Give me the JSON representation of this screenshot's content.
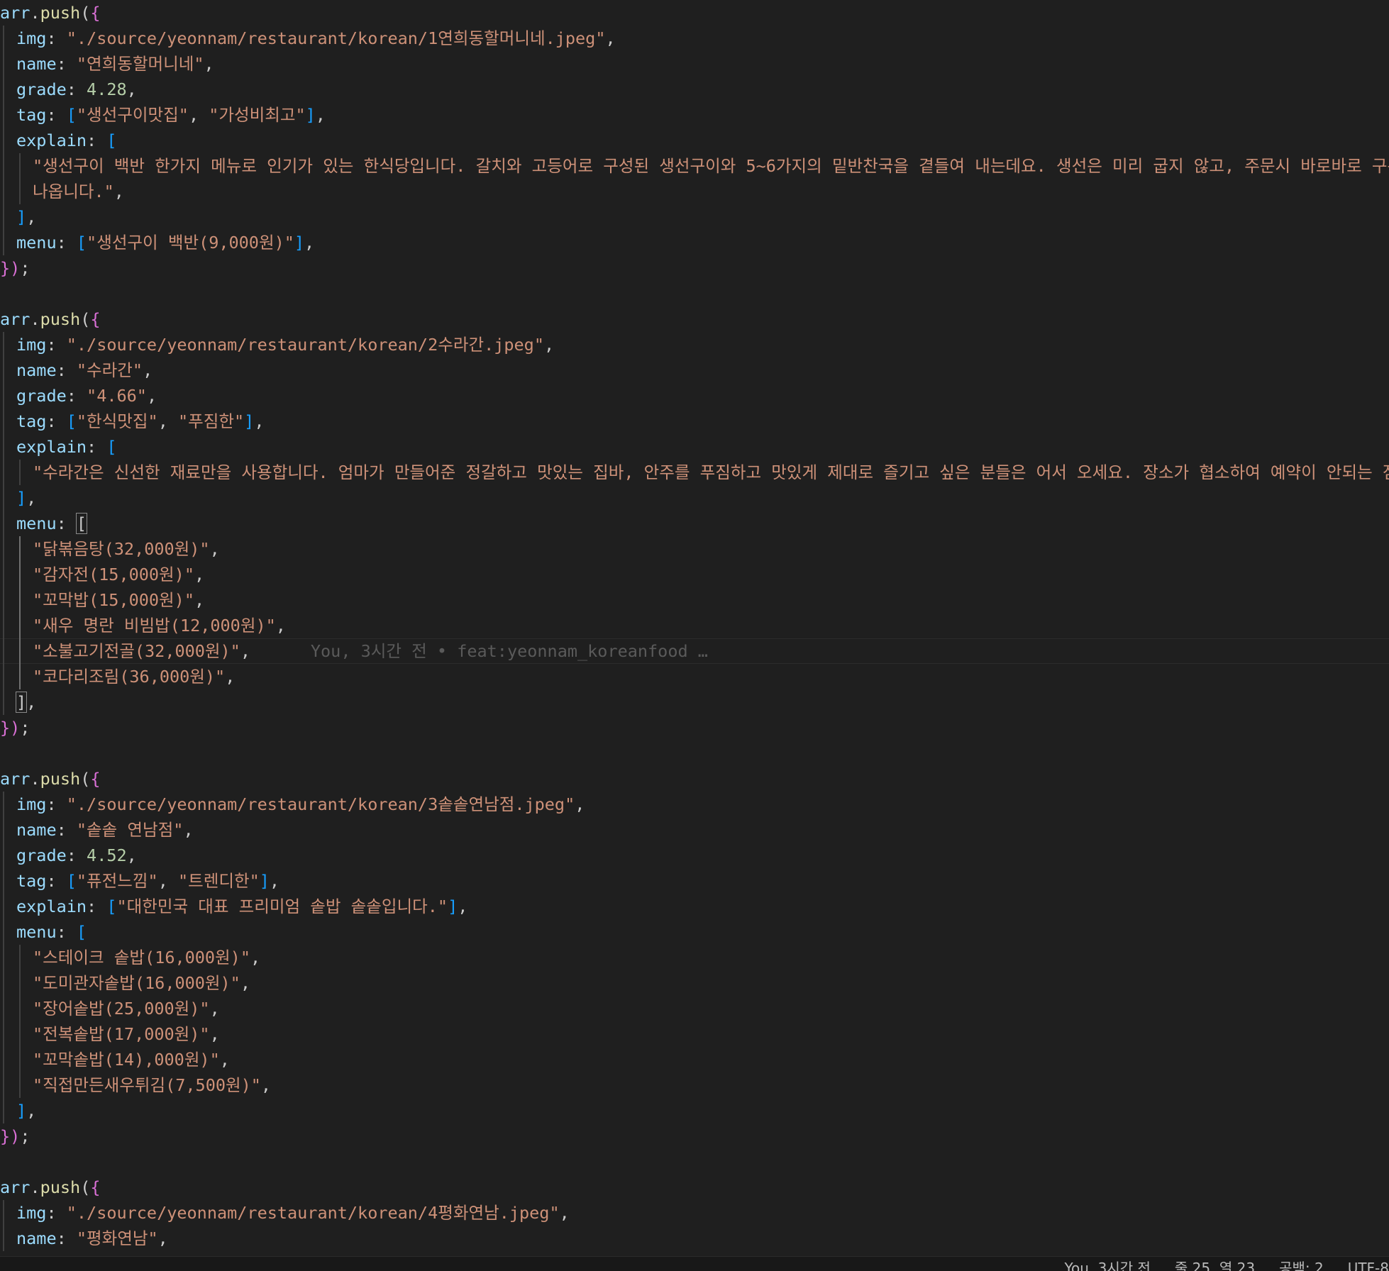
{
  "editor": {
    "lines": [
      [
        [
          "v",
          "arr"
        ],
        [
          "p",
          "."
        ],
        [
          "f",
          "push"
        ],
        [
          "p",
          "("
        ],
        [
          "b1",
          "{"
        ]
      ],
      [
        [
          "k",
          "img"
        ],
        [
          "p",
          ": "
        ],
        [
          "s",
          "\"./source/yeonnam/restaurant/korean/1연희동할머니네.jpeg\""
        ],
        [
          "p",
          ","
        ]
      ],
      [
        [
          "k",
          "name"
        ],
        [
          "p",
          ": "
        ],
        [
          "s",
          "\"연희동할머니네\""
        ],
        [
          "p",
          ","
        ]
      ],
      [
        [
          "k",
          "grade"
        ],
        [
          "p",
          ": "
        ],
        [
          "n",
          "4.28"
        ],
        [
          "p",
          ","
        ]
      ],
      [
        [
          "k",
          "tag"
        ],
        [
          "p",
          ": "
        ],
        [
          "b2",
          "["
        ],
        [
          "s",
          "\"생선구이맛집\""
        ],
        [
          "p",
          ", "
        ],
        [
          "s",
          "\"가성비최고\""
        ],
        [
          "b2",
          "]"
        ],
        [
          "p",
          ","
        ]
      ],
      [
        [
          "k",
          "explain"
        ],
        [
          "p",
          ": "
        ],
        [
          "b2",
          "["
        ]
      ],
      [
        [
          "s",
          "\"생선구이 백반 한가지 메뉴로 인기가 있는 한식당입니다. 갈치와 고등어로 구성된 생선구이와 5~6가지의 밑반찬국을 곁들여 내는데요. 생선은 미리 굽지 않고, 주문시 바로바로 구워내"
        ]
      ],
      [
        [
          "s",
          "나옵니다.\""
        ],
        [
          "p",
          ","
        ]
      ],
      [
        [
          "b2",
          "]"
        ],
        [
          "p",
          ","
        ]
      ],
      [
        [
          "k",
          "menu"
        ],
        [
          "p",
          ": "
        ],
        [
          "b2",
          "["
        ],
        [
          "s",
          "\"생선구이 백반(9,000원)\""
        ],
        [
          "b2",
          "]"
        ],
        [
          "p",
          ","
        ]
      ],
      [
        [
          "b1",
          "}"
        ],
        [
          "b1",
          ")"
        ],
        [
          "p",
          ";"
        ]
      ],
      [],
      [
        [
          "v",
          "arr"
        ],
        [
          "p",
          "."
        ],
        [
          "f",
          "push"
        ],
        [
          "p",
          "("
        ],
        [
          "b1",
          "{"
        ]
      ],
      [
        [
          "k",
          "img"
        ],
        [
          "p",
          ": "
        ],
        [
          "s",
          "\"./source/yeonnam/restaurant/korean/2수라간.jpeg\""
        ],
        [
          "p",
          ","
        ]
      ],
      [
        [
          "k",
          "name"
        ],
        [
          "p",
          ": "
        ],
        [
          "s",
          "\"수라간\""
        ],
        [
          "p",
          ","
        ]
      ],
      [
        [
          "k",
          "grade"
        ],
        [
          "p",
          ": "
        ],
        [
          "s",
          "\"4.66\""
        ],
        [
          "p",
          ","
        ]
      ],
      [
        [
          "k",
          "tag"
        ],
        [
          "p",
          ": "
        ],
        [
          "b2",
          "["
        ],
        [
          "s",
          "\"한식맛집\""
        ],
        [
          "p",
          ", "
        ],
        [
          "s",
          "\"푸짐한\""
        ],
        [
          "b2",
          "]"
        ],
        [
          "p",
          ","
        ]
      ],
      [
        [
          "k",
          "explain"
        ],
        [
          "p",
          ": "
        ],
        [
          "b2",
          "["
        ]
      ],
      [
        [
          "s",
          "\"수라간은 신선한 재료만을 사용합니다. 엄마가 만들어준 정갈하고 맛있는 집바, 안주를 푸짐하고 맛있게 제대로 즐기고 싶은 분들은 어서 오세요. 장소가 협소하여 예약이 안되는 점 양"
        ]
      ],
      [
        [
          "b2",
          "]"
        ],
        [
          "p",
          ","
        ]
      ],
      [
        [
          "k",
          "menu"
        ],
        [
          "p",
          ": "
        ],
        [
          "bm",
          "["
        ]
      ],
      [
        [
          "s",
          "\"닭볶음탕(32,000원)\""
        ],
        [
          "p",
          ","
        ]
      ],
      [
        [
          "s",
          "\"감자전(15,000원)\""
        ],
        [
          "p",
          ","
        ]
      ],
      [
        [
          "s",
          "\"꼬막밥(15,000원)\""
        ],
        [
          "p",
          ","
        ]
      ],
      [
        [
          "s",
          "\"새우 명란 비빔밥(12,000원)\""
        ],
        [
          "p",
          ","
        ]
      ],
      [
        [
          "s",
          "\"소불고기전골(32,000원)\""
        ],
        [
          "p",
          ",      "
        ],
        [
          "blame",
          "You, 3시간 전 • feat:yeonnam_koreanfood …"
        ]
      ],
      [
        [
          "s",
          "\"코다리조림(36,000원)\""
        ],
        [
          "p",
          ","
        ]
      ],
      [
        [
          "bm",
          "]"
        ],
        [
          "p",
          ","
        ]
      ],
      [
        [
          "b1",
          "}"
        ],
        [
          "b1",
          ")"
        ],
        [
          "p",
          ";"
        ]
      ],
      [],
      [
        [
          "v",
          "arr"
        ],
        [
          "p",
          "."
        ],
        [
          "f",
          "push"
        ],
        [
          "p",
          "("
        ],
        [
          "b1",
          "{"
        ]
      ],
      [
        [
          "k",
          "img"
        ],
        [
          "p",
          ": "
        ],
        [
          "s",
          "\"./source/yeonnam/restaurant/korean/3솥솥연남점.jpeg\""
        ],
        [
          "p",
          ","
        ]
      ],
      [
        [
          "k",
          "name"
        ],
        [
          "p",
          ": "
        ],
        [
          "s",
          "\"솥솥 연남점\""
        ],
        [
          "p",
          ","
        ]
      ],
      [
        [
          "k",
          "grade"
        ],
        [
          "p",
          ": "
        ],
        [
          "n",
          "4.52"
        ],
        [
          "p",
          ","
        ]
      ],
      [
        [
          "k",
          "tag"
        ],
        [
          "p",
          ": "
        ],
        [
          "b2",
          "["
        ],
        [
          "s",
          "\"퓨전느낌\""
        ],
        [
          "p",
          ", "
        ],
        [
          "s",
          "\"트렌디한\""
        ],
        [
          "b2",
          "]"
        ],
        [
          "p",
          ","
        ]
      ],
      [
        [
          "k",
          "explain"
        ],
        [
          "p",
          ": "
        ],
        [
          "b2",
          "["
        ],
        [
          "s",
          "\"대한민국 대표 프리미엄 솥밥 솥솥입니다.\""
        ],
        [
          "b2",
          "]"
        ],
        [
          "p",
          ","
        ]
      ],
      [
        [
          "k",
          "menu"
        ],
        [
          "p",
          ": "
        ],
        [
          "b2",
          "["
        ]
      ],
      [
        [
          "s",
          "\"스테이크 솥밥(16,000원)\""
        ],
        [
          "p",
          ","
        ]
      ],
      [
        [
          "s",
          "\"도미관자솥밥(16,000원)\""
        ],
        [
          "p",
          ","
        ]
      ],
      [
        [
          "s",
          "\"장어솥밥(25,000원)\""
        ],
        [
          "p",
          ","
        ]
      ],
      [
        [
          "s",
          "\"전복솥밥(17,000원)\""
        ],
        [
          "p",
          ","
        ]
      ],
      [
        [
          "s",
          "\"꼬막솥밥(14),000원)\""
        ],
        [
          "p",
          ","
        ]
      ],
      [
        [
          "s",
          "\"직접만든새우튀김(7,500원)\""
        ],
        [
          "p",
          ","
        ]
      ],
      [
        [
          "b2",
          "]"
        ],
        [
          "p",
          ","
        ]
      ],
      [
        [
          "b1",
          "}"
        ],
        [
          "b1",
          ")"
        ],
        [
          "p",
          ";"
        ]
      ],
      [],
      [
        [
          "v",
          "arr"
        ],
        [
          "p",
          "."
        ],
        [
          "f",
          "push"
        ],
        [
          "p",
          "("
        ],
        [
          "b1",
          "{"
        ]
      ],
      [
        [
          "k",
          "img"
        ],
        [
          "p",
          ": "
        ],
        [
          "s",
          "\"./source/yeonnam/restaurant/korean/4평화연남.jpeg\""
        ],
        [
          "p",
          ","
        ]
      ],
      [
        [
          "k",
          "name"
        ],
        [
          "p",
          ": "
        ],
        [
          "s",
          "\"평화연남\""
        ],
        [
          "p",
          ","
        ]
      ]
    ]
  },
  "statusbar": {
    "blame": "You, 3시간 전",
    "cursor": "줄 25, 열 23",
    "indent": "공백: 2",
    "encoding": "UTF-8"
  },
  "colors": {
    "background": "#1f1f1f",
    "string": "#ce9178",
    "number": "#b5cea8",
    "key": "#9cdcfe",
    "function": "#dcdcaa",
    "bracket1": "#da70d6",
    "bracket2": "#179fff"
  }
}
